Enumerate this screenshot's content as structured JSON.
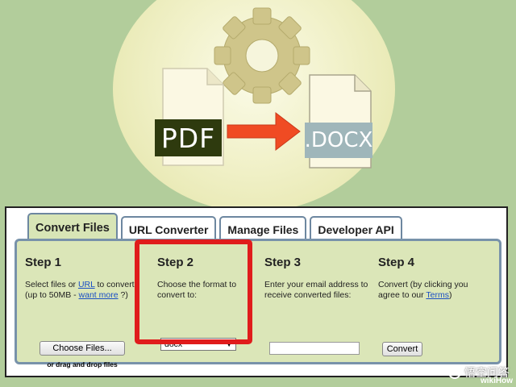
{
  "illustration": {
    "source_format": "PDF",
    "target_format": ".DOCX",
    "colors": {
      "gear": "#cfc58a",
      "arrow": "#f04b23",
      "pdf_bg": "#2e3a0e",
      "docx_bg": "#9fb6ba"
    }
  },
  "tabs": [
    {
      "label": "Convert Files",
      "active": true
    },
    {
      "label": "URL Converter",
      "active": false
    },
    {
      "label": "Manage Files",
      "active": false
    },
    {
      "label": "Developer API",
      "active": false
    }
  ],
  "steps": {
    "step1": {
      "title": "Step 1",
      "text_before": "Select files or ",
      "url_link": "URL",
      "text_middle": " to convert (up to 50MB - ",
      "want_more_link": "want more",
      "text_after": " ?)",
      "button": "Choose Files...",
      "drag_text": "or drag and drop files"
    },
    "step2": {
      "title": "Step 2",
      "description": "Choose the format to convert to:",
      "selected_format": "docx"
    },
    "step3": {
      "title": "Step 3",
      "description": "Enter your email address to receive converted files:",
      "email_value": ""
    },
    "step4": {
      "title": "Step 4",
      "text_before": "Convert (by clicking you agree to our ",
      "terms_link": "Terms",
      "text_after": ")",
      "button": "Convert"
    }
  },
  "watermark": {
    "text": "悟空问答",
    "brand": "wikiHow"
  }
}
